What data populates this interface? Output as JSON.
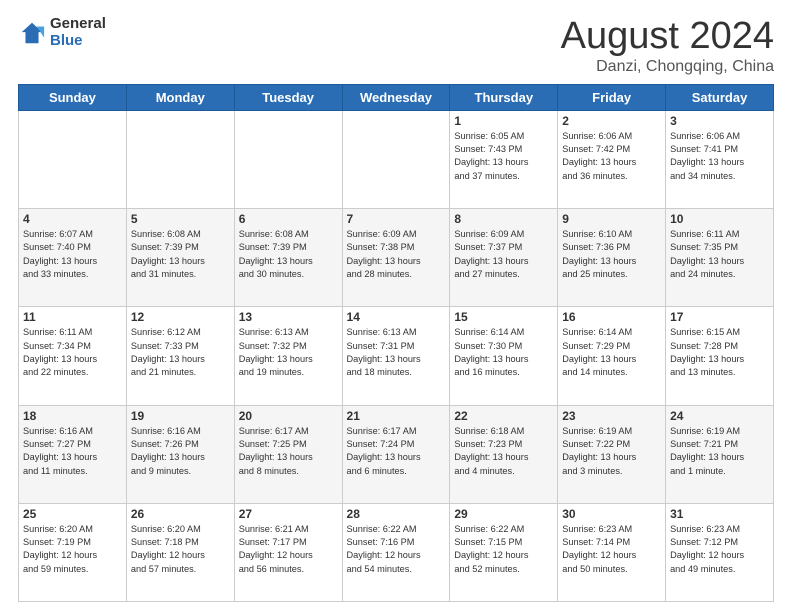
{
  "header": {
    "logo_general": "General",
    "logo_blue": "Blue",
    "month": "August 2024",
    "location": "Danzi, Chongqing, China"
  },
  "days_of_week": [
    "Sunday",
    "Monday",
    "Tuesday",
    "Wednesday",
    "Thursday",
    "Friday",
    "Saturday"
  ],
  "weeks": [
    [
      {
        "day": "",
        "info": ""
      },
      {
        "day": "",
        "info": ""
      },
      {
        "day": "",
        "info": ""
      },
      {
        "day": "",
        "info": ""
      },
      {
        "day": "1",
        "info": "Sunrise: 6:05 AM\nSunset: 7:43 PM\nDaylight: 13 hours\nand 37 minutes."
      },
      {
        "day": "2",
        "info": "Sunrise: 6:06 AM\nSunset: 7:42 PM\nDaylight: 13 hours\nand 36 minutes."
      },
      {
        "day": "3",
        "info": "Sunrise: 6:06 AM\nSunset: 7:41 PM\nDaylight: 13 hours\nand 34 minutes."
      }
    ],
    [
      {
        "day": "4",
        "info": "Sunrise: 6:07 AM\nSunset: 7:40 PM\nDaylight: 13 hours\nand 33 minutes."
      },
      {
        "day": "5",
        "info": "Sunrise: 6:08 AM\nSunset: 7:39 PM\nDaylight: 13 hours\nand 31 minutes."
      },
      {
        "day": "6",
        "info": "Sunrise: 6:08 AM\nSunset: 7:39 PM\nDaylight: 13 hours\nand 30 minutes."
      },
      {
        "day": "7",
        "info": "Sunrise: 6:09 AM\nSunset: 7:38 PM\nDaylight: 13 hours\nand 28 minutes."
      },
      {
        "day": "8",
        "info": "Sunrise: 6:09 AM\nSunset: 7:37 PM\nDaylight: 13 hours\nand 27 minutes."
      },
      {
        "day": "9",
        "info": "Sunrise: 6:10 AM\nSunset: 7:36 PM\nDaylight: 13 hours\nand 25 minutes."
      },
      {
        "day": "10",
        "info": "Sunrise: 6:11 AM\nSunset: 7:35 PM\nDaylight: 13 hours\nand 24 minutes."
      }
    ],
    [
      {
        "day": "11",
        "info": "Sunrise: 6:11 AM\nSunset: 7:34 PM\nDaylight: 13 hours\nand 22 minutes."
      },
      {
        "day": "12",
        "info": "Sunrise: 6:12 AM\nSunset: 7:33 PM\nDaylight: 13 hours\nand 21 minutes."
      },
      {
        "day": "13",
        "info": "Sunrise: 6:13 AM\nSunset: 7:32 PM\nDaylight: 13 hours\nand 19 minutes."
      },
      {
        "day": "14",
        "info": "Sunrise: 6:13 AM\nSunset: 7:31 PM\nDaylight: 13 hours\nand 18 minutes."
      },
      {
        "day": "15",
        "info": "Sunrise: 6:14 AM\nSunset: 7:30 PM\nDaylight: 13 hours\nand 16 minutes."
      },
      {
        "day": "16",
        "info": "Sunrise: 6:14 AM\nSunset: 7:29 PM\nDaylight: 13 hours\nand 14 minutes."
      },
      {
        "day": "17",
        "info": "Sunrise: 6:15 AM\nSunset: 7:28 PM\nDaylight: 13 hours\nand 13 minutes."
      }
    ],
    [
      {
        "day": "18",
        "info": "Sunrise: 6:16 AM\nSunset: 7:27 PM\nDaylight: 13 hours\nand 11 minutes."
      },
      {
        "day": "19",
        "info": "Sunrise: 6:16 AM\nSunset: 7:26 PM\nDaylight: 13 hours\nand 9 minutes."
      },
      {
        "day": "20",
        "info": "Sunrise: 6:17 AM\nSunset: 7:25 PM\nDaylight: 13 hours\nand 8 minutes."
      },
      {
        "day": "21",
        "info": "Sunrise: 6:17 AM\nSunset: 7:24 PM\nDaylight: 13 hours\nand 6 minutes."
      },
      {
        "day": "22",
        "info": "Sunrise: 6:18 AM\nSunset: 7:23 PM\nDaylight: 13 hours\nand 4 minutes."
      },
      {
        "day": "23",
        "info": "Sunrise: 6:19 AM\nSunset: 7:22 PM\nDaylight: 13 hours\nand 3 minutes."
      },
      {
        "day": "24",
        "info": "Sunrise: 6:19 AM\nSunset: 7:21 PM\nDaylight: 13 hours\nand 1 minute."
      }
    ],
    [
      {
        "day": "25",
        "info": "Sunrise: 6:20 AM\nSunset: 7:19 PM\nDaylight: 12 hours\nand 59 minutes."
      },
      {
        "day": "26",
        "info": "Sunrise: 6:20 AM\nSunset: 7:18 PM\nDaylight: 12 hours\nand 57 minutes."
      },
      {
        "day": "27",
        "info": "Sunrise: 6:21 AM\nSunset: 7:17 PM\nDaylight: 12 hours\nand 56 minutes."
      },
      {
        "day": "28",
        "info": "Sunrise: 6:22 AM\nSunset: 7:16 PM\nDaylight: 12 hours\nand 54 minutes."
      },
      {
        "day": "29",
        "info": "Sunrise: 6:22 AM\nSunset: 7:15 PM\nDaylight: 12 hours\nand 52 minutes."
      },
      {
        "day": "30",
        "info": "Sunrise: 6:23 AM\nSunset: 7:14 PM\nDaylight: 12 hours\nand 50 minutes."
      },
      {
        "day": "31",
        "info": "Sunrise: 6:23 AM\nSunset: 7:12 PM\nDaylight: 12 hours\nand 49 minutes."
      }
    ]
  ]
}
